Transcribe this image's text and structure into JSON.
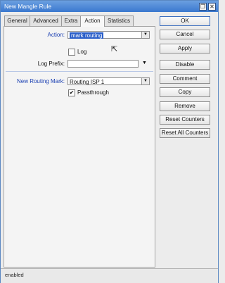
{
  "window": {
    "title": "New Mangle Rule",
    "restore_glyph": "❐",
    "close_glyph": "✕"
  },
  "tabs": [
    {
      "label": "General"
    },
    {
      "label": "Advanced"
    },
    {
      "label": "Extra"
    },
    {
      "label": "Action",
      "active": true
    },
    {
      "label": "Statistics"
    }
  ],
  "form": {
    "action_label": "Action:",
    "action_value": "mark routing",
    "log_checkbox_label": "Log",
    "log_checked": false,
    "log_prefix_label": "Log Prefix:",
    "log_prefix_value": "",
    "routing_mark_label": "New Routing Mark:",
    "routing_mark_value": "Routing ISP 1",
    "passthrough_label": "Passthrough",
    "passthrough_checked": true,
    "check_glyph": "✔",
    "dropdown_glyph": "▼"
  },
  "buttons": {
    "ok": "OK",
    "cancel": "Cancel",
    "apply": "Apply",
    "disable": "Disable",
    "comment": "Comment",
    "copy": "Copy",
    "remove": "Remove",
    "reset_counters": "Reset Counters",
    "reset_all_counters": "Reset All Counters"
  },
  "status": {
    "text": "enabled"
  },
  "colors": {
    "title_bar": "#3a78cf",
    "selection": "#2b5fc9",
    "label_blue": "#1a3fb2"
  }
}
